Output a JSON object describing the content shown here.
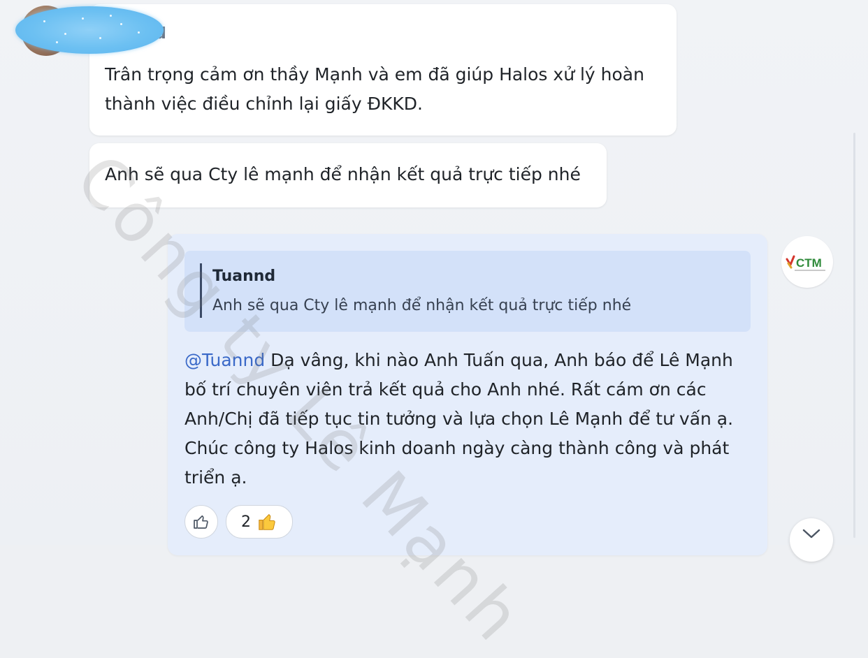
{
  "messages": {
    "first": {
      "sender_partial": "d",
      "text": "Trân trọng cảm ơn thầy Mạnh và em đã giúp Halos xử lý hoàn thành việc điều chỉnh lại giấy ĐKKD."
    },
    "second": {
      "text": "Anh sẽ qua Cty lê mạnh để nhận kết quả trực tiếp nhé"
    },
    "reply": {
      "quote_name": "Tuannd",
      "quote_text": "Anh sẽ qua Cty lê mạnh để nhận kết quả trực tiếp nhé",
      "mention": "@Tuannd",
      "text": " Dạ vâng, khi nào Anh Tuấn qua, Anh báo để Lê Mạnh bố trí chuyên viên trả kết quả cho Anh nhé. Rất cám ơn các Anh/Chị đã tiếp tục tin tưởng và lựa chọn Lê Mạnh để tư vấn ạ. Chúc công ty Halos kinh doanh ngày càng thành công và phát triển ạ.",
      "reaction_count": "2"
    }
  },
  "company_logo": {
    "text": "CTM",
    "icon": "company-logo-icon"
  },
  "watermark": "Công ty Lê Mạnh",
  "icons": {
    "like": "thumbs-up-outline-icon",
    "reaction": "thumbs-up-emoji-icon",
    "scroll": "chevron-down-icon"
  },
  "colors": {
    "mention": "#3a69c8",
    "reply_bubble": "#e5edfb",
    "quote_box": "#d3e1f9"
  }
}
